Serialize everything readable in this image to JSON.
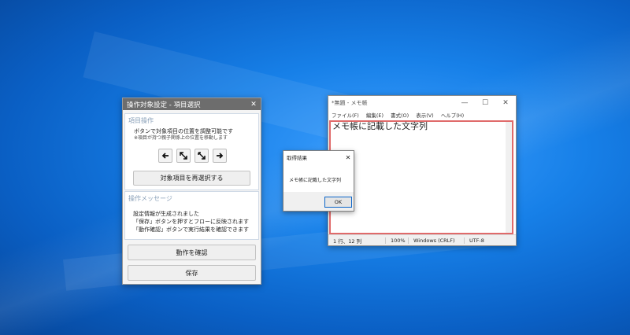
{
  "tool_window": {
    "title": "操作対象設定 - 項目選択",
    "close": "✕",
    "section1": {
      "heading": "項目操作",
      "line1": "ボタンで対象項目の位置を調整可能です",
      "note": "※項目が持つ親子関係上の位置を移動します",
      "arrows": [
        "🡐",
        "⤡",
        "⤡",
        "🡒"
      ],
      "reselect_label": "対象項目を再選択する"
    },
    "section2": {
      "heading": "操作メッセージ",
      "lines": [
        "設定情報が生成されました",
        "「保存」ボタンを押すとフローに反映されます",
        "「動作確認」ボタンで実行結果を確認できます"
      ]
    },
    "verify_label": "動作を確認",
    "save_label": "保存"
  },
  "notepad": {
    "title": "*無題 - メモ帳",
    "controls": [
      "—",
      "☐",
      "✕"
    ],
    "menu": [
      "ファイル(F)",
      "編集(E)",
      "書式(O)",
      "表示(V)",
      "ヘルプ(H)"
    ],
    "content": "メモ帳に記載した文字列",
    "status": {
      "position": "1 行、12 列",
      "zoom": "100%",
      "eol": "Windows (CRLF)",
      "encoding": "UTF-8"
    }
  },
  "dialog": {
    "title": "取得結果",
    "close": "✕",
    "message": "メモ帳に記載した文字列",
    "ok_label": "OK"
  }
}
